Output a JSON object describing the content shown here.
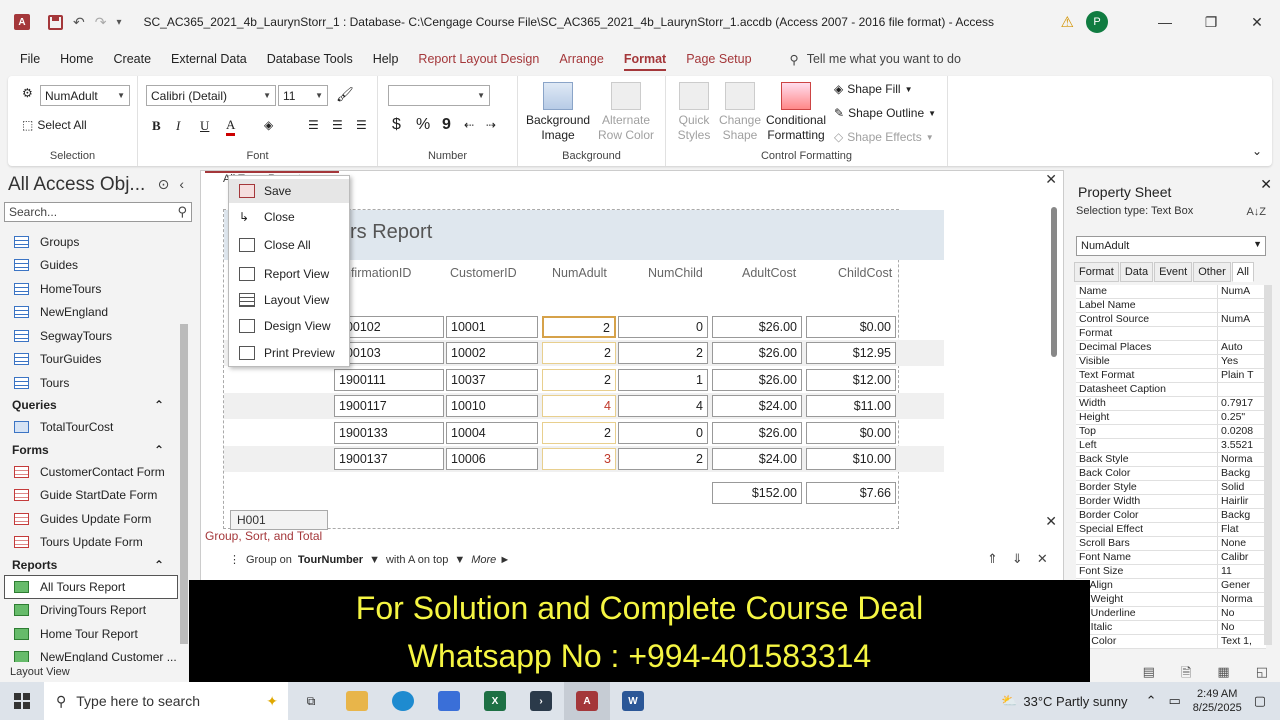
{
  "window": {
    "app_letter": "A",
    "title": "SC_AC365_2021_4b_LaurynStorr_1 : Database- C:\\Cengage Course File\\SC_AC365_2021_4b_LaurynStorr_1.accdb (Access 2007 - 2016 file format)  -  Access",
    "user_initial": "P"
  },
  "tabs": [
    "File",
    "Home",
    "Create",
    "External Data",
    "Database Tools",
    "Help"
  ],
  "context_tabs": [
    "Report Layout Design",
    "Arrange"
  ],
  "active_tab": "Format",
  "trailing_tab": "Page Setup",
  "tell_me": "Tell me what you want to do",
  "ribbon": {
    "selection": {
      "object_combo": "NumAdult",
      "select_all": "Select All",
      "label": "Selection"
    },
    "font": {
      "family": "Calibri (Detail)",
      "size": "11",
      "label": "Font",
      "bold": "B",
      "italic": "I",
      "underline": "U",
      "color_a": "A"
    },
    "number": {
      "format": "",
      "currency": "$",
      "percent": "%",
      "comma": "9",
      "label": "Number"
    },
    "background": {
      "image": "Background Image",
      "alt_row": "Alternate Row Color",
      "label": "Background"
    },
    "control_formatting": {
      "quick_styles": "Quick Styles",
      "change_shape": "Change Shape",
      "conditional": "Conditional Formatting",
      "shape_fill": "Shape Fill",
      "shape_outline": "Shape Outline",
      "shape_effects": "Shape Effects",
      "label": "Control Formatting"
    }
  },
  "nav": {
    "title": "All Access Obj...",
    "search_placeholder": "Search...",
    "tables": [
      "Groups",
      "Guides",
      "HomeTours",
      "NewEngland",
      "SegwayTours",
      "TourGuides",
      "Tours"
    ],
    "queries_label": "Queries",
    "queries": [
      "TotalTourCost"
    ],
    "forms_label": "Forms",
    "forms": [
      "CustomerContact Form",
      "Guide StartDate Form",
      "Guides Update Form",
      "Tours Update Form"
    ],
    "reports_label": "Reports",
    "reports": [
      "All Tours Report",
      "DrivingTours Report",
      "Home Tour Report",
      "NewEngland Customer ..."
    ]
  },
  "document": {
    "tab_label": "All Tours Report",
    "report_title": "rs Report",
    "columns": [
      "nfirmationID",
      "CustomerID",
      "NumAdult",
      "NumChild",
      "AdultCost",
      "ChildCost"
    ],
    "rows": [
      [
        "900102",
        "10001",
        "2",
        "0",
        "$26.00",
        "$0.00"
      ],
      [
        "900103",
        "10002",
        "2",
        "2",
        "$26.00",
        "$12.95"
      ],
      [
        "1900111",
        "10037",
        "2",
        "1",
        "$26.00",
        "$12.00"
      ],
      [
        "1900117",
        "10010",
        "4",
        "4",
        "$24.00",
        "$11.00"
      ],
      [
        "1900133",
        "10004",
        "2",
        "0",
        "$26.00",
        "$0.00"
      ],
      [
        "1900137",
        "10006",
        "3",
        "2",
        "$24.00",
        "$10.00"
      ]
    ],
    "totals": [
      "$152.00",
      "$7.66"
    ],
    "footer_field": "H001"
  },
  "group_sort": {
    "label": "Group, Sort, and Total",
    "group_on": "Group on",
    "group_field": "TourNumber",
    "order": "with A on top",
    "more": "More ►"
  },
  "context_menu": [
    "Save",
    "Close",
    "Close All",
    "Report View",
    "Layout View",
    "Design View",
    "Print Preview"
  ],
  "property_sheet": {
    "title": "Property Sheet",
    "selection_type": "Selection type:  Text Box",
    "sort_icon": "A↓Z",
    "object": "NumAdult",
    "tabs": [
      "Format",
      "Data",
      "Event",
      "Other",
      "All"
    ],
    "active_tab": "All",
    "rows": [
      [
        "Name",
        "NumA"
      ],
      [
        "Label Name",
        ""
      ],
      [
        "Control Source",
        "NumA"
      ],
      [
        "Format",
        ""
      ],
      [
        "Decimal Places",
        "Auto"
      ],
      [
        "Visible",
        "Yes"
      ],
      [
        "Text Format",
        "Plain T"
      ],
      [
        "Datasheet Caption",
        ""
      ],
      [
        "Width",
        "0.7917"
      ],
      [
        "Height",
        "0.25\""
      ],
      [
        "Top",
        "0.0208"
      ],
      [
        "Left",
        "3.5521"
      ],
      [
        "Back Style",
        "Norma"
      ],
      [
        "Back Color",
        "Backg"
      ],
      [
        "Border Style",
        "Solid"
      ],
      [
        "Border Width",
        "Hairlir"
      ],
      [
        "Border Color",
        "Backg"
      ],
      [
        "Special Effect",
        "Flat"
      ],
      [
        "Scroll Bars",
        "None"
      ],
      [
        "Font Name",
        "Calibr"
      ],
      [
        "Font Size",
        "11"
      ],
      [
        "xt Align",
        "Gener"
      ],
      [
        "nt Weight",
        "Norma"
      ],
      [
        "nt Underline",
        "No"
      ],
      [
        "nt Italic",
        "No"
      ],
      [
        "re Color",
        "Text 1,"
      ]
    ]
  },
  "status": {
    "view": "Layout View"
  },
  "banner": {
    "line1": "For Solution and Complete Course Deal",
    "line2": "Whatsapp No : +994-401583314"
  },
  "taskbar": {
    "search_placeholder": "Type here to search",
    "weather": "33°C  Partly sunny",
    "time": "2:49 AM",
    "date": "8/25/2025"
  },
  "colors": {
    "accent": "#a4373a",
    "banner_text": "#f5f542"
  }
}
